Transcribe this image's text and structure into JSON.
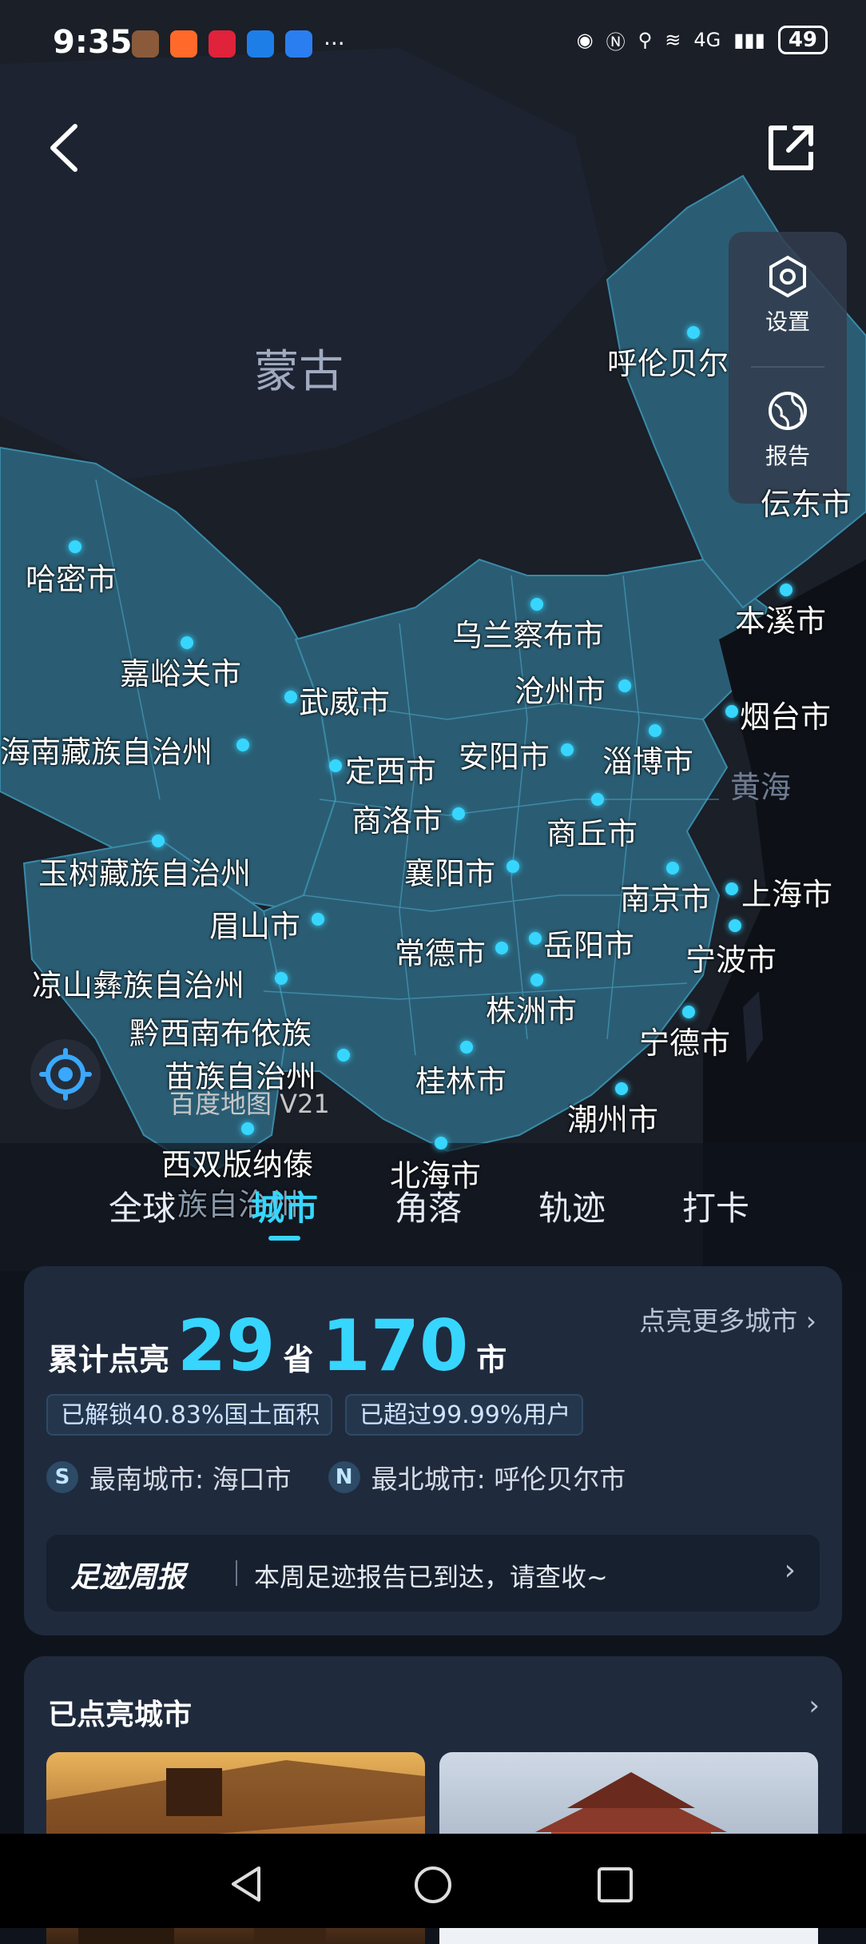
{
  "status_bar": {
    "time": "9:35",
    "battery": "49",
    "network": "4G",
    "more": "···"
  },
  "map": {
    "region_labels": {
      "mongolia": "蒙古",
      "yellow_sea": "黄海"
    },
    "cities": [
      {
        "key": "hulunbuir",
        "name": "呼伦贝尔"
      },
      {
        "key": "qiqihar_partial",
        "name": "伝东市"
      },
      {
        "key": "hami",
        "name": "哈密市"
      },
      {
        "key": "jiayuguan",
        "name": "嘉峪关市"
      },
      {
        "key": "wuwei",
        "name": "武威市"
      },
      {
        "key": "hainan_zangzu",
        "name": "海南藏族自治州"
      },
      {
        "key": "dingxi",
        "name": "定西市"
      },
      {
        "key": "yushu",
        "name": "玉树藏族自治州"
      },
      {
        "key": "meishan",
        "name": "眉山市"
      },
      {
        "key": "liangshan",
        "name": "凉山彝族自治州"
      },
      {
        "key": "qianxinan_1",
        "name": "黔西南布依族"
      },
      {
        "key": "qianxinan_2",
        "name": "苗族自治州"
      },
      {
        "key": "xishuangbanna_1",
        "name": "西双版纳傣"
      },
      {
        "key": "xishuangbanna_2",
        "name": "族自治州"
      },
      {
        "key": "wulanchabu",
        "name": "乌兰察布市"
      },
      {
        "key": "cangzhou",
        "name": "沧州市"
      },
      {
        "key": "benxi",
        "name": "本溪市"
      },
      {
        "key": "yantai",
        "name": "烟台市"
      },
      {
        "key": "anyang",
        "name": "安阳市"
      },
      {
        "key": "zibo",
        "name": "淄博市"
      },
      {
        "key": "shangluo",
        "name": "商洛市"
      },
      {
        "key": "shangqiu",
        "name": "商丘市"
      },
      {
        "key": "xiangyang",
        "name": "襄阳市"
      },
      {
        "key": "nanjing",
        "name": "南京市"
      },
      {
        "key": "shanghai",
        "name": "上海市"
      },
      {
        "key": "changde",
        "name": "常德市"
      },
      {
        "key": "yueyang",
        "name": "岳阳市"
      },
      {
        "key": "ningbo",
        "name": "宁波市"
      },
      {
        "key": "zhuzhou",
        "name": "株洲市"
      },
      {
        "key": "ningde",
        "name": "宁德市"
      },
      {
        "key": "guilin",
        "name": "桂林市"
      },
      {
        "key": "chaozhou",
        "name": "潮州市"
      },
      {
        "key": "beihai",
        "name": "北海市"
      }
    ],
    "watermark": "百度地图 V21",
    "side_panel": {
      "settings": "设置",
      "report": "报告"
    }
  },
  "tabs": [
    {
      "label": "全球"
    },
    {
      "label": "城市",
      "active": true
    },
    {
      "label": "角落"
    },
    {
      "label": "轨迹"
    },
    {
      "label": "打卡"
    }
  ],
  "summary_card": {
    "more_link": "点亮更多城市",
    "label_prefix": "累计点亮",
    "province_count": "29",
    "province_unit": "省",
    "city_count": "170",
    "city_unit": "市",
    "pill_area": "已解锁40.83%国土面积",
    "pill_users": "已超过99.99%用户",
    "south_badge": "S",
    "south_text": "最南城市: 海口市",
    "north_badge": "N",
    "north_text": "最北城市: 呼伦贝尔市",
    "weekly_title": "足迹周报",
    "weekly_text": "本周足迹报告已到达，请查收~"
  },
  "cities_card": {
    "title": "已点亮城市"
  },
  "colors": {
    "accent": "#37d6ff",
    "map_bg": "#1a1f28",
    "lit_region": "#2a5d74",
    "card_bg": "#1f2a3d"
  }
}
